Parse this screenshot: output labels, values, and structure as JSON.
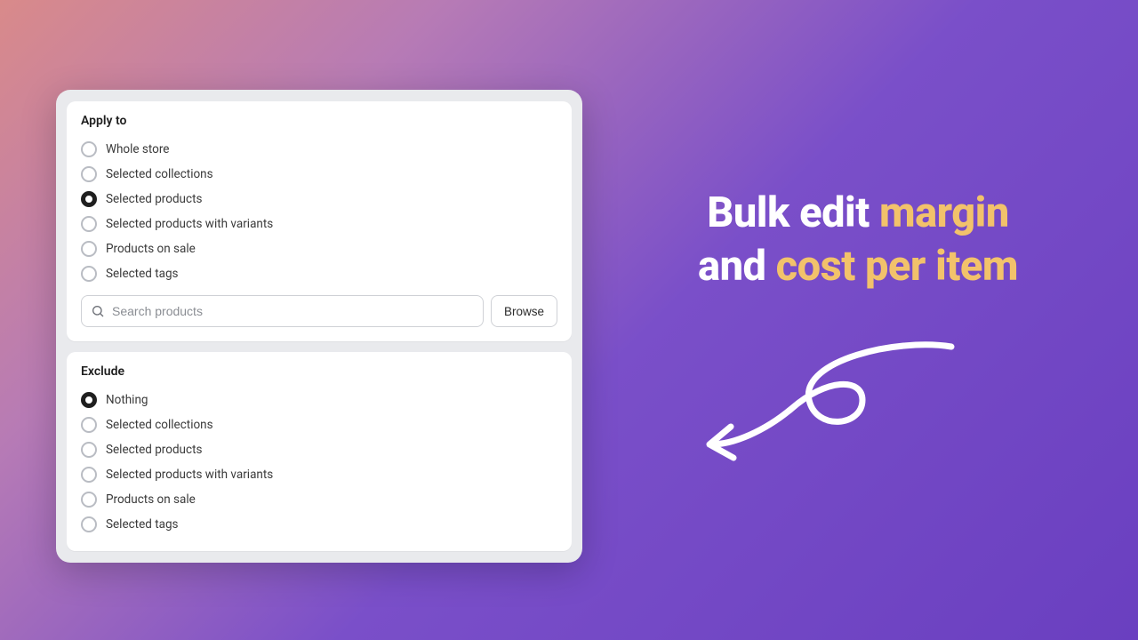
{
  "headline": {
    "prefix1": "Bulk edit ",
    "gold1": "margin",
    "mid": " and ",
    "gold2": "cost per item"
  },
  "applyTo": {
    "title": "Apply to",
    "options": [
      "Whole store",
      "Selected collections",
      "Selected products",
      "Selected products with variants",
      "Products on sale",
      "Selected tags"
    ],
    "selectedIndex": 2
  },
  "search": {
    "placeholder": "Search products",
    "browseLabel": "Browse"
  },
  "exclude": {
    "title": "Exclude",
    "options": [
      "Nothing",
      "Selected collections",
      "Selected products",
      "Selected products with variants",
      "Products on sale",
      "Selected tags"
    ],
    "selectedIndex": 0
  }
}
